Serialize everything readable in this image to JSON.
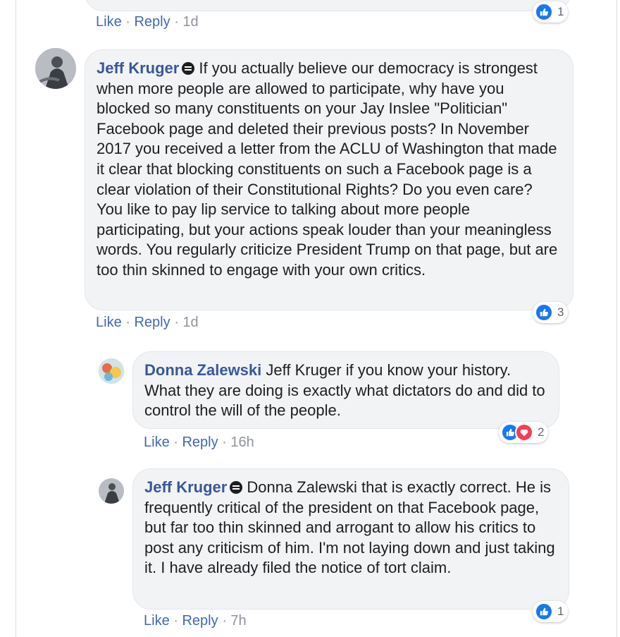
{
  "colors": {
    "link": "#385898",
    "action": "#4267b2",
    "meta": "#90949c",
    "bubble": "#f2f3f5",
    "like": "#1877f2",
    "love": "#f33e58"
  },
  "top_fragment": {
    "reaction_count": "1",
    "like": "Like",
    "reply": "Reply",
    "time": "1d"
  },
  "comments": [
    {
      "author": "Jeff Kruger",
      "badge_icon": "top-fan-badge-icon",
      "text": "If you actually believe our democracy is strongest when more people are allowed to participate, why have you blocked so many constituents on your Jay Inslee \"Politician\" Facebook page and deleted their previous posts? In November 2017 you received a letter from the ACLU of Washington that made it clear that blocking constituents on such a Facebook page is a clear violation of their Constitutional Rights? Do you even care? You like to pay lip service to talking about more people participating, but your actions speak louder than your meaningless words. You regularly criticize President Trump on that page, but are too thin skinned to engage with your own critics.",
      "reaction_count": "3",
      "like": "Like",
      "reply": "Reply",
      "time": "1d"
    },
    {
      "author": "Donna Zalewski",
      "mention": "Jeff Kruger",
      "text": "if you know your history. What they are doing is exactly what dictators do and did to control the will of the people.",
      "reaction_count": "2",
      "like": "Like",
      "reply": "Reply",
      "time": "16h"
    },
    {
      "author": "Jeff Kruger",
      "badge_icon": "top-fan-badge-icon",
      "mention": "Donna Zalewski",
      "text": "that is exactly correct. He is frequently critical of the president on that Facebook page, but far too thin skinned and arrogant to allow his critics to post any criticism of him. I'm not laying down and just taking it. I have already filed the notice of tort claim.",
      "reaction_count": "1",
      "like": "Like",
      "reply": "Reply",
      "time": "7h"
    }
  ]
}
